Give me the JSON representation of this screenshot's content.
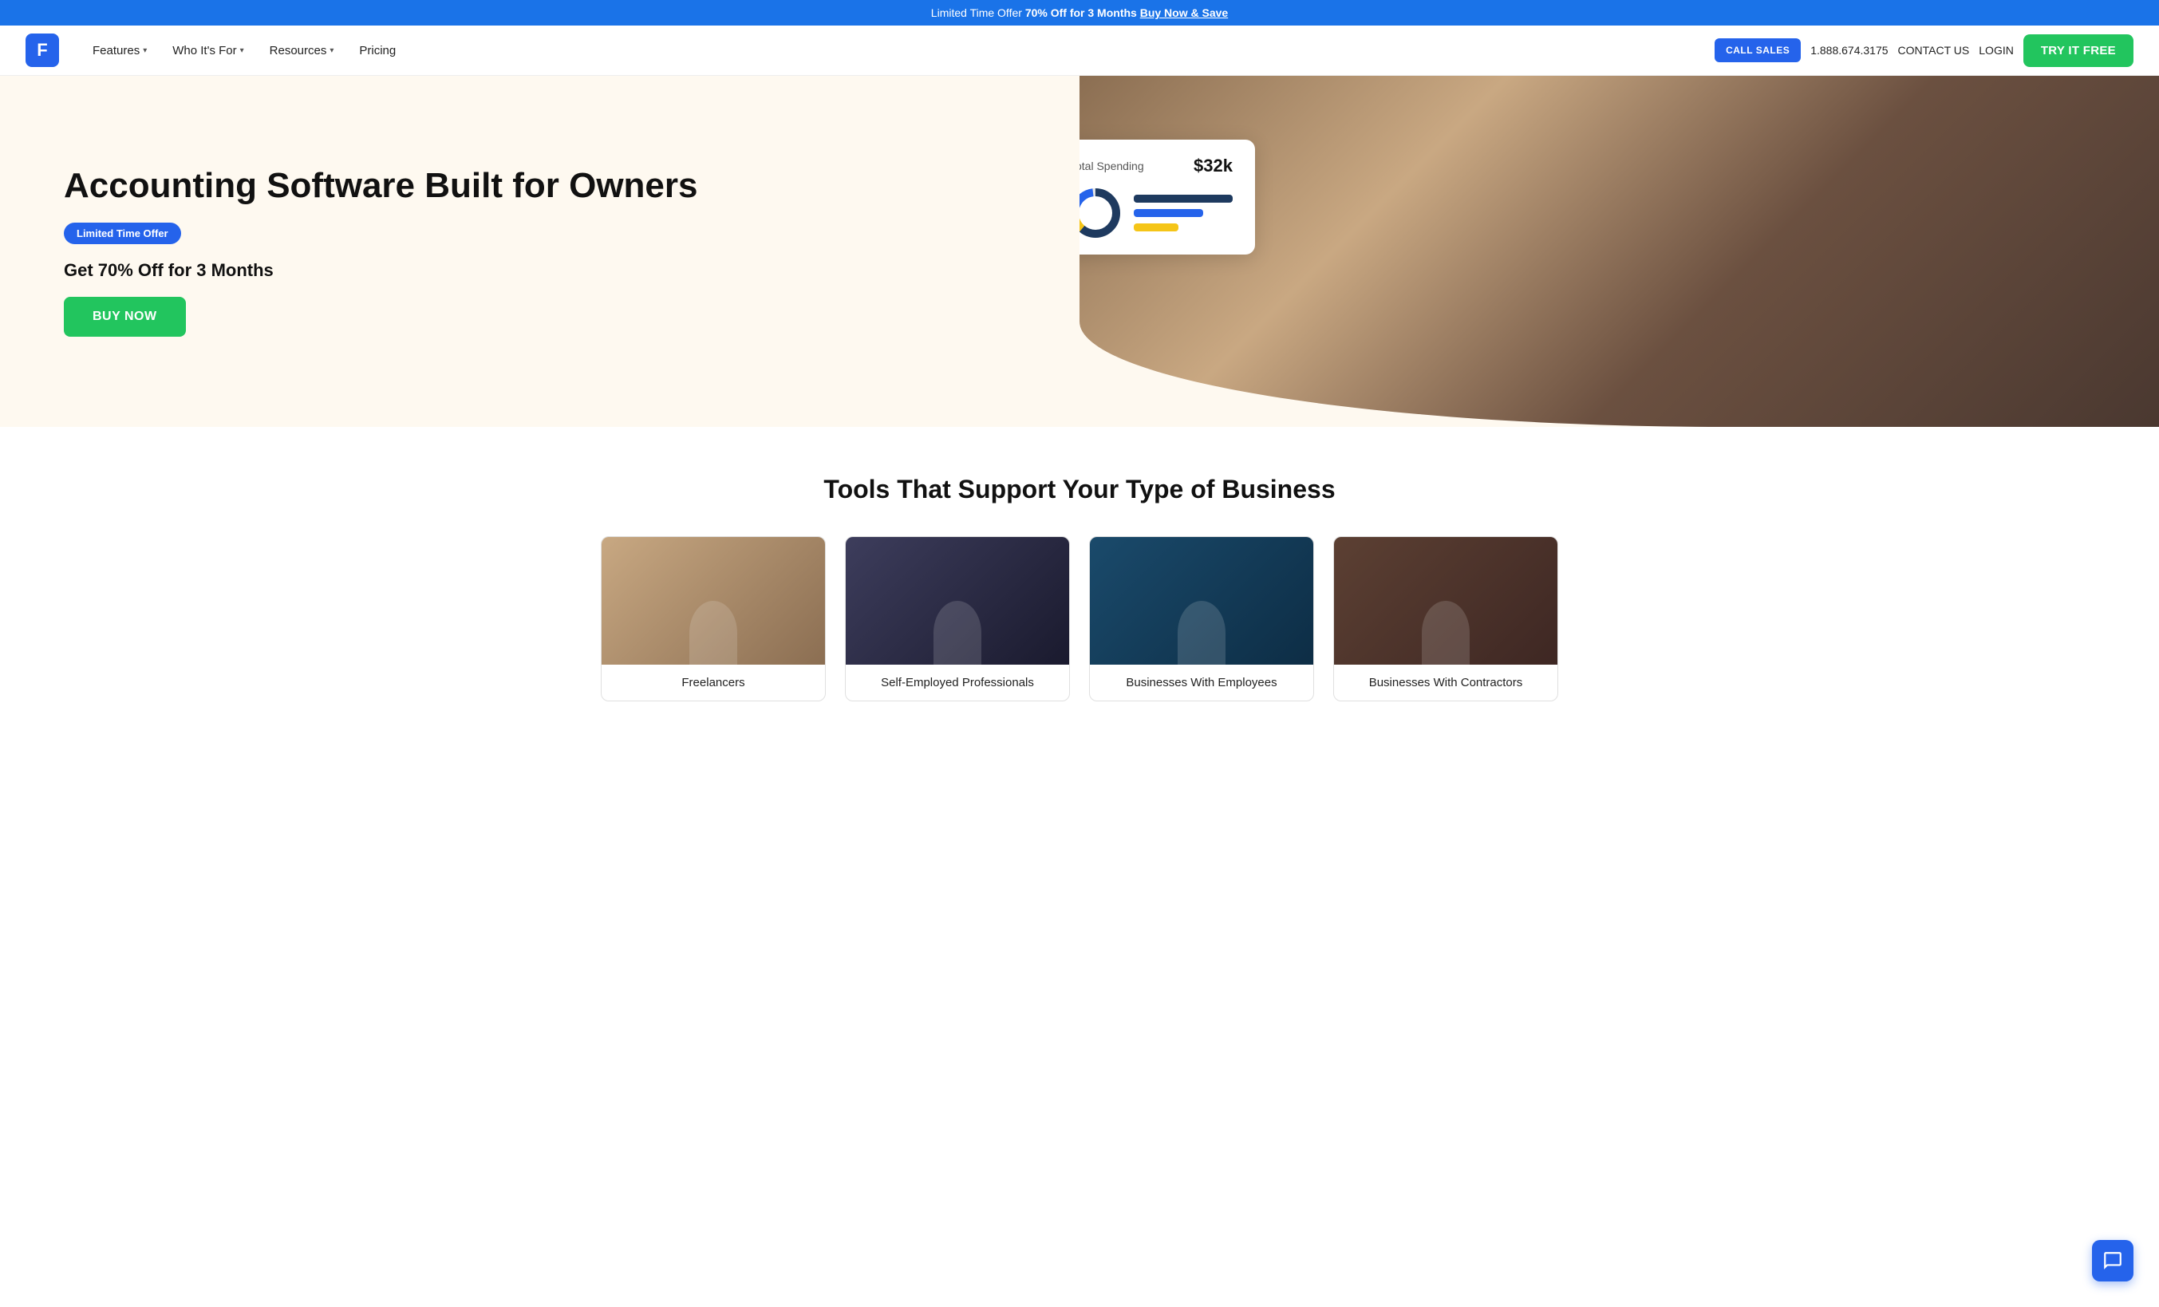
{
  "banner": {
    "prefix": "Limited Time Offer",
    "highlight": "70% Off for 3 Months",
    "link_text": "Buy Now & Save"
  },
  "nav": {
    "logo_letter": "F",
    "items": [
      {
        "label": "Features",
        "has_dropdown": true
      },
      {
        "label": "Who It's For",
        "has_dropdown": true
      },
      {
        "label": "Resources",
        "has_dropdown": true
      },
      {
        "label": "Pricing",
        "has_dropdown": false
      }
    ],
    "call_sales": "CALL SALES",
    "phone": "1.888.674.3175",
    "contact_us": "CONTACT US",
    "login": "LOGIN",
    "try_free": "TRY IT FREE"
  },
  "hero": {
    "title": "Accounting Software Built for Owners",
    "badge": "Limited Time Offer",
    "subtitle": "Get 70% Off for 3 Months",
    "cta": "BUY NOW",
    "spending_card": {
      "label": "Total Spending",
      "amount": "$32k"
    }
  },
  "tools_section": {
    "title": "Tools That Support Your Type of Business",
    "cards": [
      {
        "label": "Freelancers",
        "img_class": "tool-img-1"
      },
      {
        "label": "Self-Employed Professionals",
        "img_class": "tool-img-2"
      },
      {
        "label": "Businesses With Employees",
        "img_class": "tool-img-3"
      },
      {
        "label": "Businesses With Contractors",
        "img_class": "tool-img-4"
      }
    ]
  }
}
